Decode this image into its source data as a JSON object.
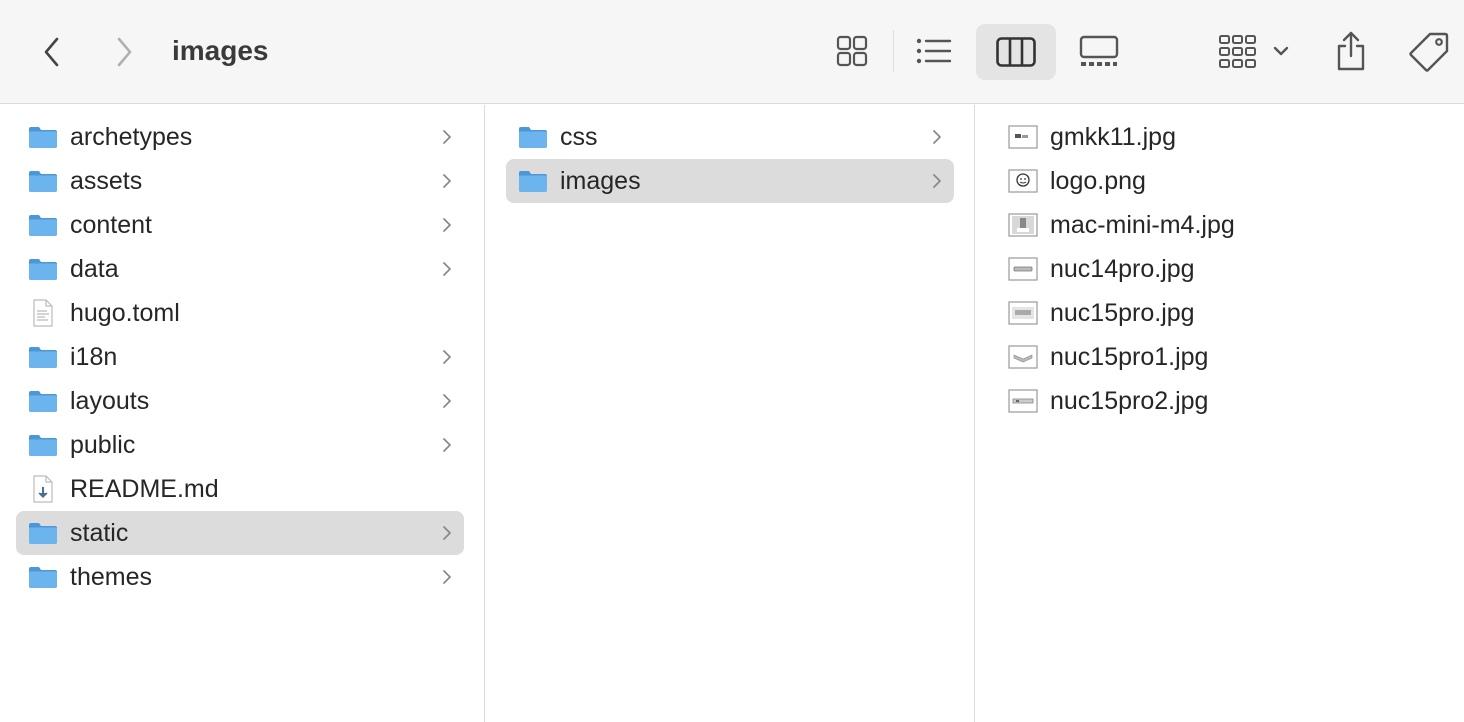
{
  "toolbar": {
    "title": "images",
    "back_icon": "chevron-left-icon",
    "forward_icon": "chevron-right-icon",
    "views": [
      "icon-view",
      "list-view",
      "column-view",
      "gallery-view"
    ],
    "active_view": "column-view",
    "group_icon": "group-by-icon",
    "share_icon": "share-icon",
    "tag_icon": "tag-icon"
  },
  "colors": {
    "folder": "#6cb4ee",
    "folder_dark": "#4a98d8",
    "selection": "#dcdcdc",
    "toolbar_bg": "#f6f6f6"
  },
  "column1": {
    "items": [
      {
        "label": "archetypes",
        "type": "folder"
      },
      {
        "label": "assets",
        "type": "folder"
      },
      {
        "label": "content",
        "type": "folder"
      },
      {
        "label": "data",
        "type": "folder"
      },
      {
        "label": "hugo.toml",
        "type": "text-file"
      },
      {
        "label": "i18n",
        "type": "folder"
      },
      {
        "label": "layouts",
        "type": "folder"
      },
      {
        "label": "public",
        "type": "folder"
      },
      {
        "label": "README.md",
        "type": "markdown-file"
      },
      {
        "label": "static",
        "type": "folder",
        "selected": true
      },
      {
        "label": "themes",
        "type": "folder"
      }
    ]
  },
  "column2": {
    "items": [
      {
        "label": "css",
        "type": "folder"
      },
      {
        "label": "images",
        "type": "folder",
        "selected": true
      }
    ]
  },
  "column3": {
    "items": [
      {
        "label": "gmkk11.jpg",
        "type": "image-file"
      },
      {
        "label": "logo.png",
        "type": "image-file"
      },
      {
        "label": "mac-mini-m4.jpg",
        "type": "image-file"
      },
      {
        "label": "nuc14pro.jpg",
        "type": "image-file"
      },
      {
        "label": "nuc15pro.jpg",
        "type": "image-file"
      },
      {
        "label": "nuc15pro1.jpg",
        "type": "image-file"
      },
      {
        "label": "nuc15pro2.jpg",
        "type": "image-file"
      }
    ]
  }
}
